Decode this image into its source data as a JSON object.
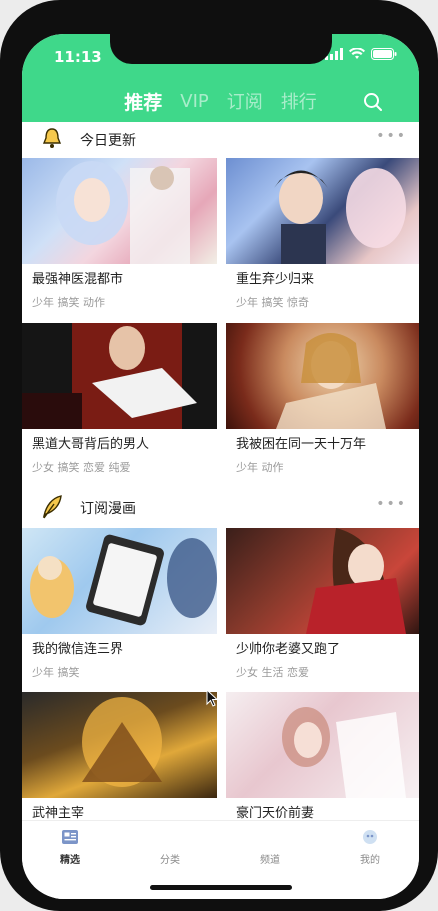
{
  "status": {
    "time": "11:13"
  },
  "tabs": [
    {
      "label": "推荐",
      "active": true
    },
    {
      "label": "VIP"
    },
    {
      "label": "订阅"
    },
    {
      "label": "排行"
    }
  ],
  "sections": [
    {
      "title": "今日更新",
      "icon": "bell-icon",
      "more": "•••",
      "items": [
        {
          "title": "最强神医混都市",
          "tags": "少年 搞笑 动作"
        },
        {
          "title": "重生弃少归来",
          "tags": "少年 搞笑 惊奇"
        },
        {
          "title": "黑道大哥背后的男人",
          "tags": "少女 搞笑 恋爱 纯爱"
        },
        {
          "title": "我被困在同一天十万年",
          "tags": "少年 动作"
        }
      ]
    },
    {
      "title": "订阅漫画",
      "icon": "feather-icon",
      "more": "•••",
      "items": [
        {
          "title": "我的微信连三界",
          "tags": "少年 搞笑"
        },
        {
          "title": "少帅你老婆又跑了",
          "tags": "少女 生活 恋爱"
        },
        {
          "title": "武神主宰",
          "tags": ""
        },
        {
          "title": "豪门天价前妻",
          "tags": ""
        }
      ]
    }
  ],
  "bottom_nav": [
    {
      "label": "精选",
      "icon": "news-icon",
      "active": true
    },
    {
      "label": "分类",
      "icon": "category-icon"
    },
    {
      "label": "频道",
      "icon": "channel-icon"
    },
    {
      "label": "我的",
      "icon": "profile-icon"
    }
  ],
  "colors": {
    "accent": "#3fd88a"
  }
}
